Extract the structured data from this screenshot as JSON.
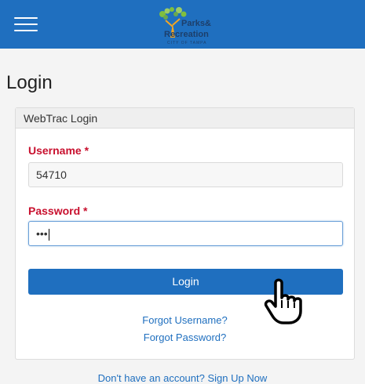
{
  "header": {
    "menu_icon": "hamburger-menu-icon",
    "logo": {
      "line1": "Parks&",
      "line2": "Recreation",
      "line3": "CITY OF TAMPA"
    },
    "bar_color": "#1f6fbf"
  },
  "page": {
    "title": "Login"
  },
  "login_card": {
    "header": "WebTrac Login",
    "username": {
      "label": "Username *",
      "value": "54710"
    },
    "password": {
      "label": "Password *",
      "value": "•••"
    },
    "login_button": "Login",
    "forgot_username": "Forgot Username?",
    "forgot_password": "Forgot Password?"
  },
  "signup_text": "Don't have an account? Sign Up Now",
  "colors": {
    "accent": "#1f6fbf",
    "required_label": "#c8102e"
  },
  "pointer_icon": "hand-pointer-icon"
}
